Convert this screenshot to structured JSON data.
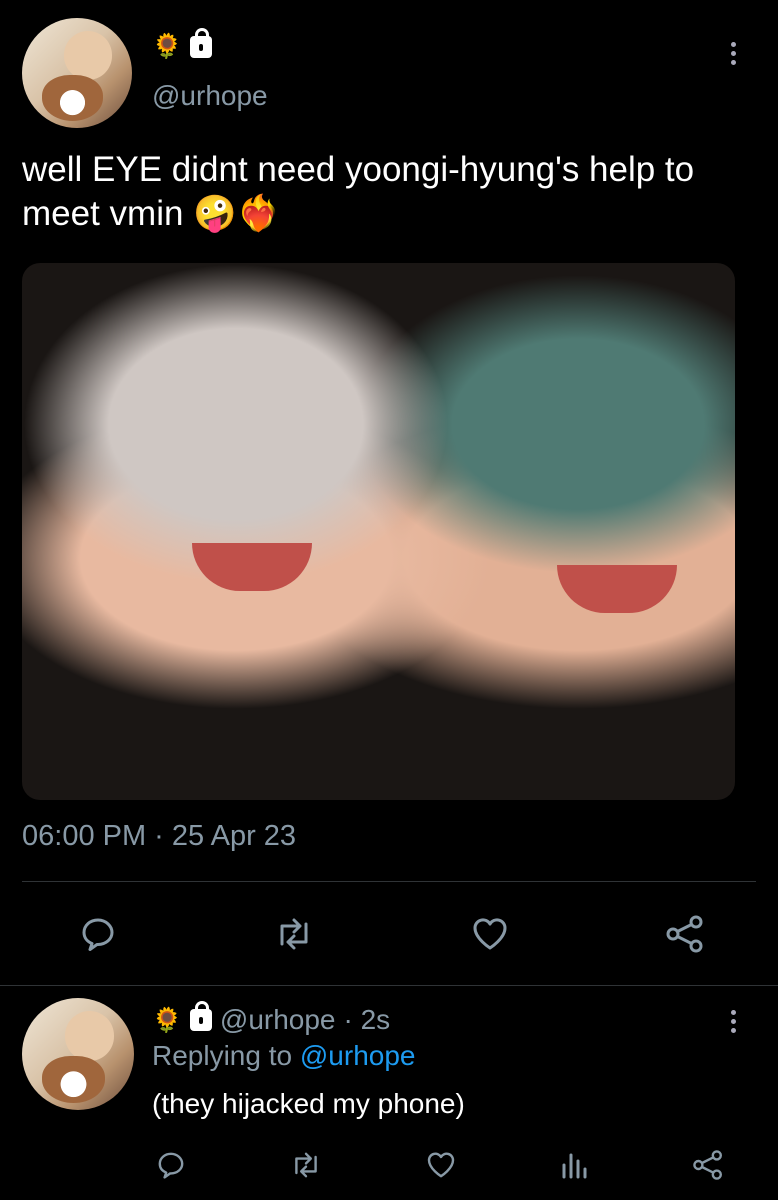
{
  "tweet": {
    "handle": "@urhope",
    "name_emojis": "🌻",
    "text": "well EYE didnt need yoongi-hyung's help to meet vmin 🤪❤️‍🔥",
    "timestamp": "06:00 PM · 25 Apr 23",
    "actions": [
      "reply-icon",
      "retweet-icon",
      "like-icon",
      "share-icon"
    ]
  },
  "reply": {
    "name_emojis": "🌻",
    "handle": "@urhope",
    "time": "· 2s",
    "replying_prefix": "Replying to",
    "replying_to": "@urhope",
    "text": "(they hijacked my phone)",
    "actions": [
      "reply-icon",
      "retweet-icon",
      "like-icon",
      "analytics-icon",
      "share-icon"
    ]
  },
  "colors": {
    "background": "#000000",
    "secondary_text": "#8899a6",
    "link": "#1d9bf0",
    "divider": "#2f3336"
  }
}
